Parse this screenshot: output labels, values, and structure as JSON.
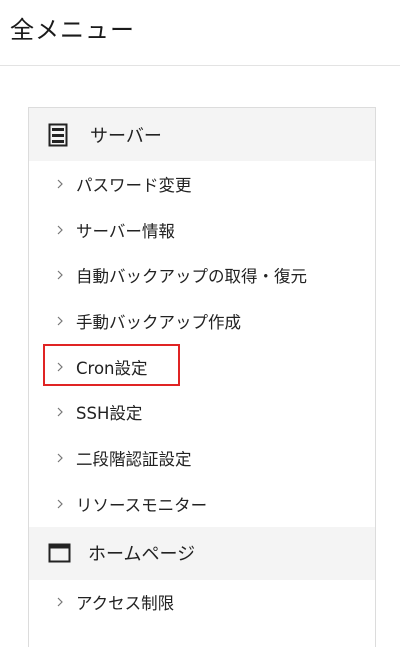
{
  "header": {
    "title": "全メニュー"
  },
  "menu": {
    "server": {
      "label": "サーバー",
      "icon": "server-icon",
      "items": [
        {
          "label": "パスワード変更"
        },
        {
          "label": "サーバー情報"
        },
        {
          "label": "自動バックアップの取得・復元"
        },
        {
          "label": "手動バックアップ作成"
        },
        {
          "label": "Cron設定"
        },
        {
          "label": "SSH設定"
        },
        {
          "label": "二段階認証設定"
        },
        {
          "label": "リソースモニター"
        }
      ]
    },
    "homepage": {
      "label": "ホームページ",
      "icon": "browser-window-icon",
      "items": [
        {
          "label": "アクセス制限"
        }
      ]
    }
  },
  "colors": {
    "highlight": "#e02424",
    "section_bg": "#f4f4f4",
    "border": "#dcdcdc"
  }
}
